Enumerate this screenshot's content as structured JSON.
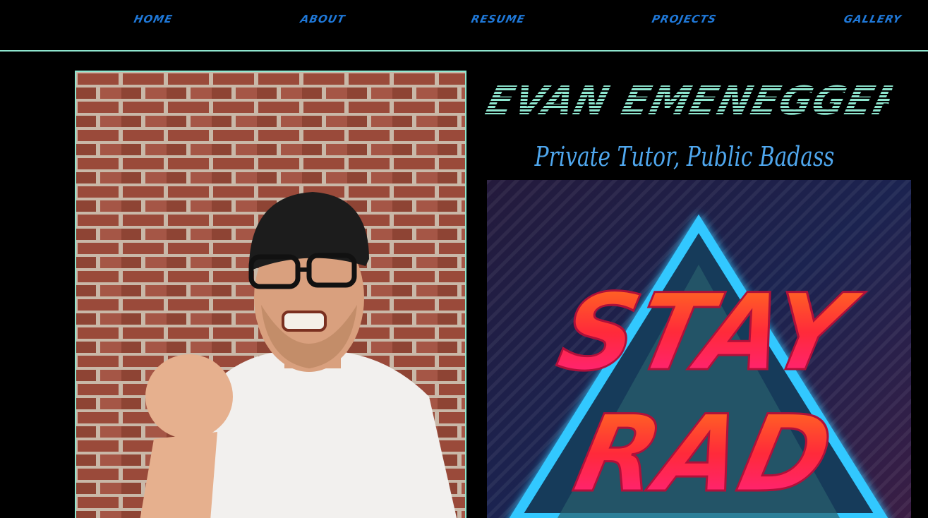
{
  "nav": {
    "items": [
      {
        "label": "HOME"
      },
      {
        "label": "ABOUT"
      },
      {
        "label": "RESUME"
      },
      {
        "label": "PROJECTS"
      },
      {
        "label": "GALLERY"
      }
    ]
  },
  "hero": {
    "name": "EVAN EMENEGGER",
    "tagline": "Private Tutor, Public Badass"
  },
  "poster": {
    "line1": "STAY",
    "line2": "RAD"
  },
  "colors": {
    "accent_mint": "#8ee6cf",
    "nav_blue": "#1f78d8",
    "tagline_blue": "#4fa7ee",
    "background": "#000000"
  }
}
